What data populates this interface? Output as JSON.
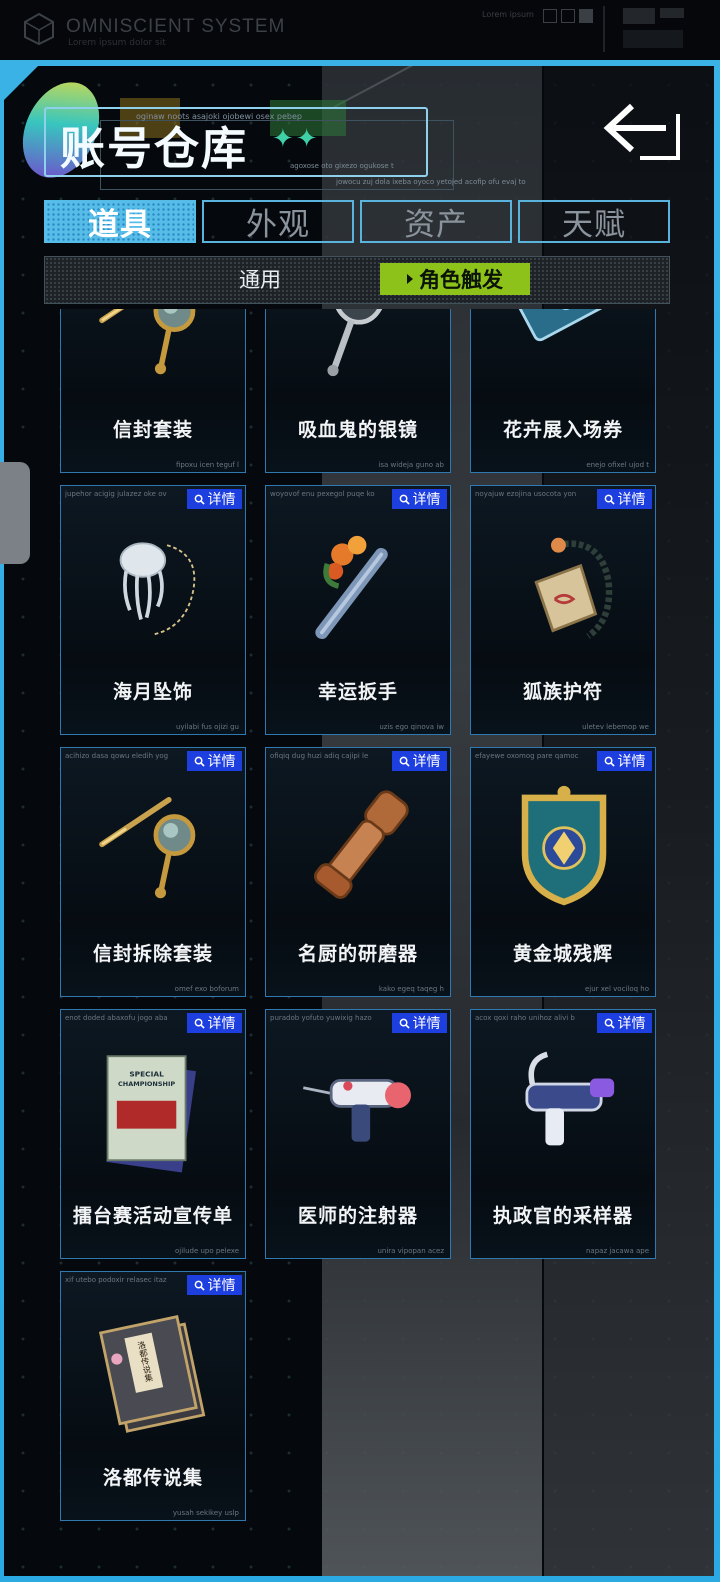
{
  "system": {
    "title": "OMNISCIENT SYSTEM",
    "subtitle": "Lorem ipsum dolor sit",
    "right_label": "Lorem ipsum"
  },
  "header": {
    "title": "账号仓库",
    "stars": "✦✦",
    "caption_top": "oginaw noots asajoki ojobewi osex pebep",
    "caption_bottom": "agoxose oto gixezo ogukose t",
    "caption_bottom2": "jowocu zuj dola ixeba oyoco yetojed acofip ofu evaj to"
  },
  "tabs": [
    {
      "label": "道具",
      "active": true
    },
    {
      "label": "外观",
      "active": false
    },
    {
      "label": "资产",
      "active": false
    },
    {
      "label": "天赋",
      "active": false
    }
  ],
  "subtabs": {
    "general": "通用",
    "character": "角色触发"
  },
  "detail_label": "详情",
  "items": [
    {
      "name": "信封套装",
      "tag": "",
      "btag": "fipoxu icen teguf l",
      "icon": "dagger-mirror-icon",
      "detail": false
    },
    {
      "name": "吸血鬼的银镜",
      "tag": "",
      "btag": "isa wideja guno ab",
      "icon": "silver-mirror-icon",
      "detail": false
    },
    {
      "name": "花卉展入场券",
      "tag": "",
      "btag": "enejo ofixel ujod t",
      "icon": "flower-ticket-icon",
      "detail": false
    },
    {
      "name": "海月坠饰",
      "tag": "jupehor acigig julazez oke ov",
      "btag": "uyilabi fus ojizi gu",
      "icon": "jellyfish-pendant-icon",
      "detail": true
    },
    {
      "name": "幸运扳手",
      "tag": "woyovof enu pexegol puqe ko",
      "btag": "uzis ego qinova iw",
      "icon": "lucky-wrench-icon",
      "detail": true
    },
    {
      "name": "狐族护符",
      "tag": "noyajuw ezojina usocota yon",
      "btag": "uletev lebemop we",
      "icon": "fox-charm-icon",
      "detail": true
    },
    {
      "name": "信封拆除套装",
      "tag": "acihizo dasa qowu eledih yog",
      "btag": "omef exo boforum",
      "icon": "dagger-mirror-icon",
      "detail": true
    },
    {
      "name": "名厨的研磨器",
      "tag": "ofiqiq dug huzi adiq cajipi le",
      "btag": "kako egeq taqeg h",
      "icon": "pepper-grinder-icon",
      "detail": true
    },
    {
      "name": "黄金城残辉",
      "tag": "efayewe oxomog pare qamoc",
      "btag": "ejur xel vociloq ho",
      "icon": "golden-crest-icon",
      "detail": true
    },
    {
      "name": "擂台赛活动宣传单",
      "tag": "enot doded abaxofu jogo aba",
      "btag": "ojilude upo pelexe",
      "icon": "championship-flyer-icon",
      "detail": true
    },
    {
      "name": "医师的注射器",
      "tag": "puradob yofuto yuwixig hazo",
      "btag": "unira vipopan acez",
      "icon": "doctor-syringe-icon",
      "detail": true
    },
    {
      "name": "执政官的采样器",
      "tag": "acox qoxi raho unihoz alivi b",
      "btag": "napaz jacawa ape",
      "icon": "sampler-gun-icon",
      "detail": true
    },
    {
      "name": "洛都传说集",
      "tag": "xif utebo podoxir relasec itaz",
      "btag": "yusah sekikey uslp",
      "icon": "legend-book-icon",
      "detail": true
    }
  ],
  "flyer": {
    "line1": "SPECIAL",
    "line2": "CHAMPIONSHIP"
  },
  "book": {
    "title": "洛都传说集"
  }
}
